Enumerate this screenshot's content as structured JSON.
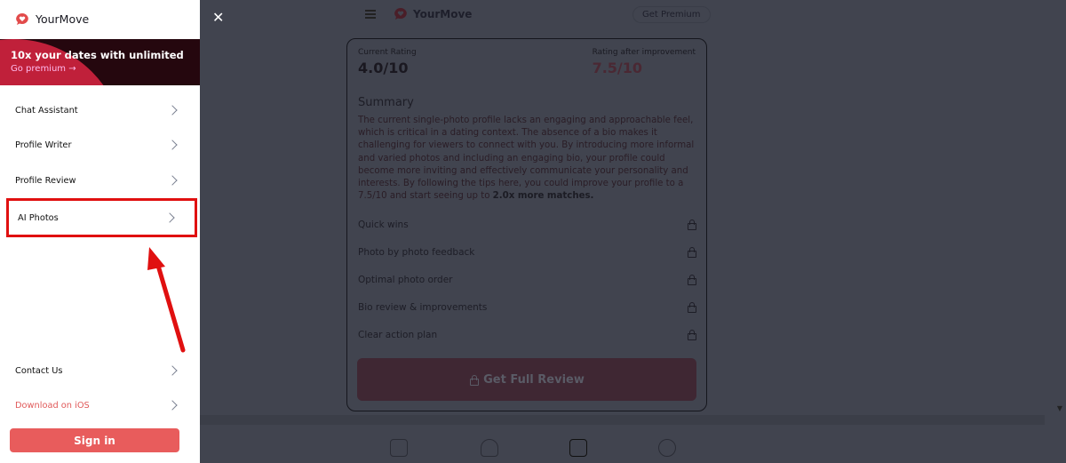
{
  "sidebar": {
    "brand": "YourMove",
    "promo": {
      "title": "10x your dates with unlimited",
      "link": "Go premium →"
    },
    "items": [
      {
        "label": "Chat Assistant"
      },
      {
        "label": "Profile Writer"
      },
      {
        "label": "Profile Review"
      },
      {
        "label": "AI Photos",
        "highlighted": true
      }
    ],
    "bottom_items": [
      {
        "label": "Contact Us"
      },
      {
        "label": "Download on iOS"
      }
    ],
    "signin": "Sign in"
  },
  "topbar": {
    "brand": "YourMove",
    "premium": "Get Premium"
  },
  "review": {
    "current_label": "Current Rating",
    "current_value": "4.0/10",
    "after_label": "Rating after improvement",
    "after_value": "7.5/10",
    "summary_title": "Summary",
    "summary_text": "The current single-photo profile lacks an engaging and approachable feel, which is critical in a dating context. The absence of a bio makes it challenging for viewers to connect with you. By introducing more informal and varied photos and including an engaging bio, your profile could become more inviting and effectively communicate your personality and interests. By following the tips here, you could improve your profile to a 7.5/10 and start seeing up to ",
    "summary_bold": "2.0x more matches.",
    "features": [
      "Quick wins",
      "Photo by photo feedback",
      "Optimal photo order",
      "Bio review & improvements",
      "Clear action plan"
    ],
    "cta": "Get Full Review"
  },
  "colors": {
    "accent": "#e85c5c",
    "highlight": "#e01010",
    "promo_bg": "#25070e",
    "overlay": "#41444f"
  }
}
